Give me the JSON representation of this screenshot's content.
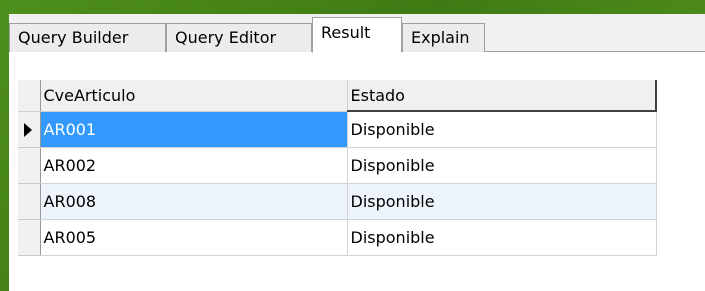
{
  "tabs": [
    {
      "label": "Query Builder",
      "active": false
    },
    {
      "label": "Query Editor",
      "active": false
    },
    {
      "label": "Result",
      "active": true
    },
    {
      "label": "Explain",
      "active": false
    }
  ],
  "grid": {
    "columns": [
      "CveArticulo",
      "Estado"
    ],
    "rows": [
      {
        "cve": "AR001",
        "estado": "Disponible",
        "current": true
      },
      {
        "cve": "AR002",
        "estado": "Disponible",
        "current": false
      },
      {
        "cve": "AR008",
        "estado": "Disponible",
        "current": false
      },
      {
        "cve": "AR005",
        "estado": "Disponible",
        "current": false
      }
    ],
    "row_indicator_icon": "current-row-arrow-icon",
    "colors": {
      "selection": "#3399ff",
      "alt_row": "#eef4fb",
      "header_bg": "#f0f0f0"
    }
  }
}
